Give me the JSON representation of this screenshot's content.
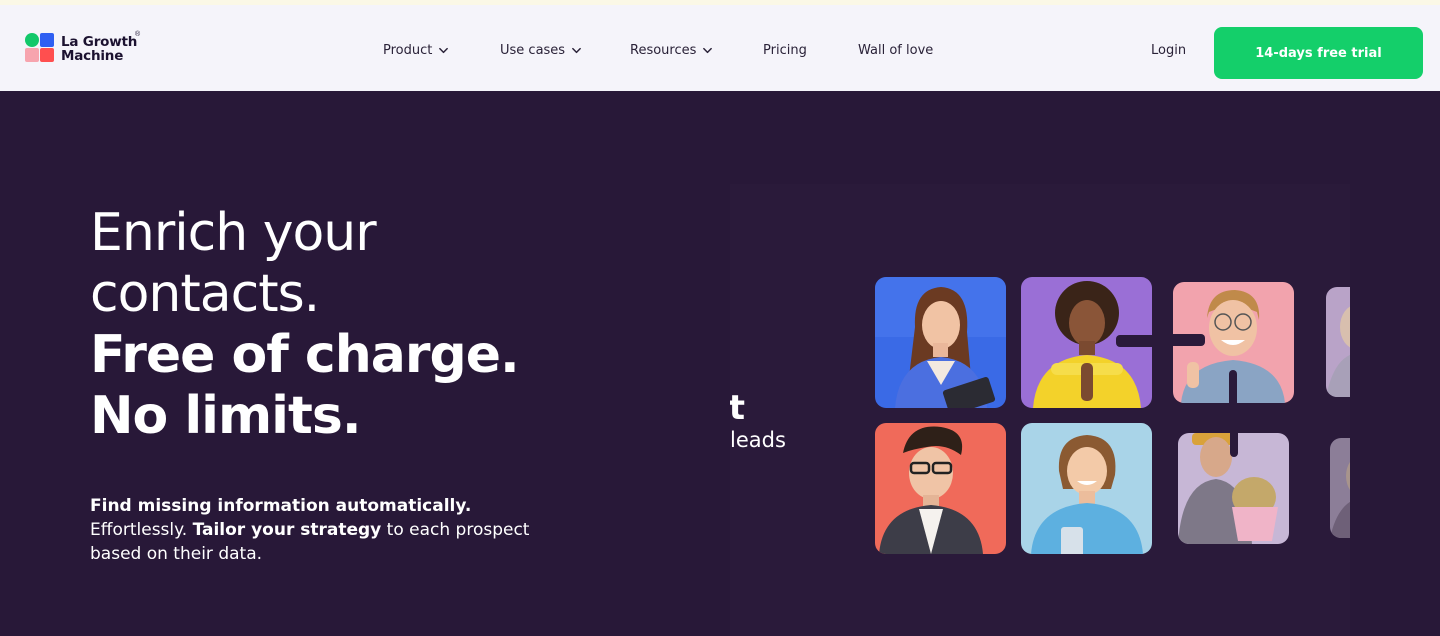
{
  "brand": {
    "line1": "La Growth",
    "line2": "Machine",
    "reg": "®",
    "colors": {
      "green": "#13c86a",
      "blue": "#2f5ff2",
      "pink": "#f7a4ae",
      "red": "#ff4f4f"
    }
  },
  "nav": {
    "items": [
      {
        "label": "Product",
        "dropdown": true,
        "icon": "chevron-down-icon"
      },
      {
        "label": "Use cases",
        "dropdown": true,
        "icon": "chevron-down-icon"
      },
      {
        "label": "Resources",
        "dropdown": true,
        "icon": "chevron-down-icon"
      },
      {
        "label": "Pricing",
        "dropdown": false
      },
      {
        "label": "Wall of love",
        "dropdown": false
      }
    ],
    "login": "Login",
    "cta": "14-days free trial"
  },
  "hero": {
    "title_line1": "Enrich your",
    "title_line2": "contacts.",
    "title_line3": "Free of charge.",
    "title_line4": "No limits.",
    "sub_bold1": "Find missing information automatically.",
    "sub_text1": "Effortlessly.",
    "sub_bold2": "Tailor your strategy",
    "sub_text2": "to each prospect based on their data."
  },
  "showcase": {
    "partial_title": "rt",
    "partial_sub": "leads"
  },
  "colors": {
    "background": "#281838",
    "navbar": "#f5f4fa",
    "cta": "#14cf6a"
  }
}
